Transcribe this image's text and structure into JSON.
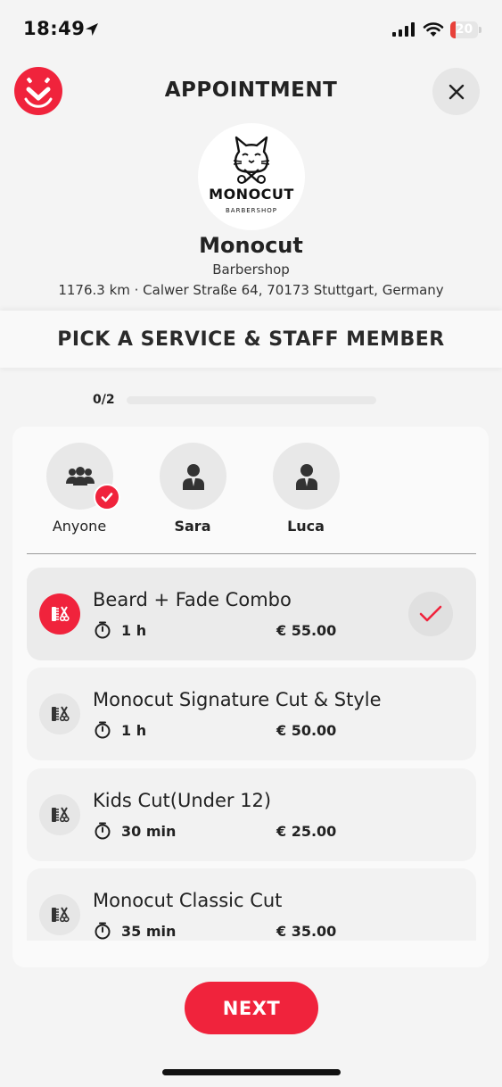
{
  "status_bar": {
    "time": "18:49",
    "battery_level": "20",
    "battery_fraction": 0.2,
    "icons": [
      "location-arrow-icon",
      "cellular-signal-icon",
      "wifi-icon",
      "battery-icon"
    ]
  },
  "header": {
    "title": "APPOINTMENT",
    "logo_icon": "clock-check-icon",
    "close_icon": "close-icon"
  },
  "shop": {
    "logo_text": "MONOCUT",
    "logo_subtext": "BARBERSHOP",
    "name": "Monocut",
    "type": "Barbershop",
    "address": "1176.3 km · Calwer Straße 64, 70173 Stuttgart, Germany"
  },
  "section": {
    "title": "PICK A SERVICE & STAFF MEMBER"
  },
  "progress": {
    "label": "0/2",
    "completed": 0,
    "total": 2
  },
  "staff": [
    {
      "name": "Anyone",
      "icon": "group-icon",
      "selected": true
    },
    {
      "name": "Sara",
      "icon": "person-icon",
      "selected": false
    },
    {
      "name": "Luca",
      "icon": "person-icon",
      "selected": false
    }
  ],
  "services": [
    {
      "name": "Beard + Fade Combo",
      "duration": "1 h",
      "price": "€ 55.00",
      "selected": true,
      "icon": "comb-scissors-icon"
    },
    {
      "name": "Monocut Signature Cut & Style",
      "duration": "1 h",
      "price": "€ 50.00",
      "selected": false,
      "icon": "comb-scissors-icon"
    },
    {
      "name": "Kids Cut(Under 12)",
      "duration": "30 min",
      "price": "€ 25.00",
      "selected": false,
      "icon": "comb-scissors-icon"
    },
    {
      "name": "Monocut Classic Cut",
      "duration": "35 min",
      "price": "€ 35.00",
      "selected": false,
      "icon": "comb-scissors-icon"
    }
  ],
  "footer": {
    "next_label": "NEXT"
  },
  "colors": {
    "accent": "#f0233c",
    "background": "#f4f4f4",
    "card": "#fafafa"
  }
}
